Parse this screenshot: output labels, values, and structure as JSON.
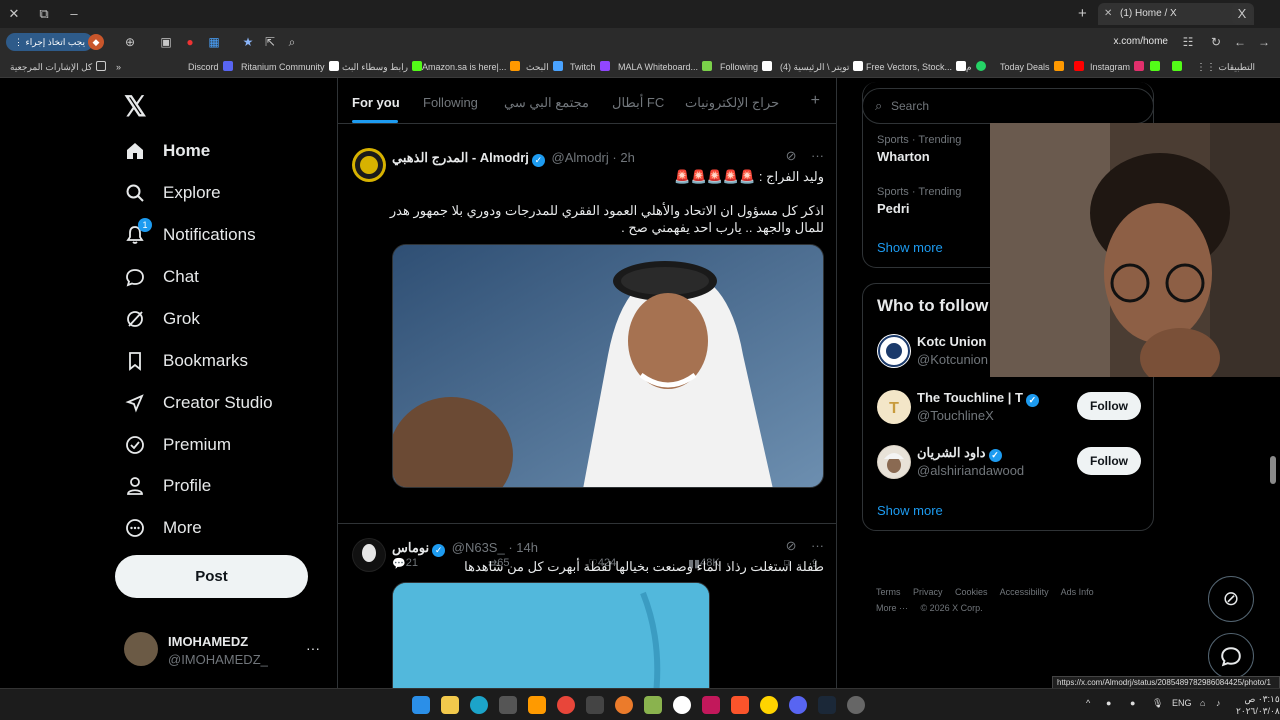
{
  "browser": {
    "tab_title": "(1) Home / X",
    "url": "x.com/home",
    "ext_button": "يجب اتخاذ إجراء",
    "bookmarks": [
      "كل الإشارات المرجعية",
      "Discord",
      "Ritanium Community",
      "رابط وسطاء البث",
      "Amazon.sa is here|...",
      "البحث",
      "Twitch",
      "MALA Whiteboard...",
      "Following",
      "تويتر \\ الرئيسية (4)",
      "Free Vectors, Stock...",
      "م",
      "Today Deals",
      "Instagram",
      "التطبيقات"
    ],
    "status_url": "https://x.com/Almodrj/status/2085489782986084425/photo/1"
  },
  "nav": {
    "items": [
      {
        "label": "Home",
        "icon": "home-icon"
      },
      {
        "label": "Explore",
        "icon": "search-icon"
      },
      {
        "label": "Notifications",
        "icon": "bell-icon",
        "badge": "1"
      },
      {
        "label": "Chat",
        "icon": "chat-icon"
      },
      {
        "label": "Grok",
        "icon": "grok-icon"
      },
      {
        "label": "Bookmarks",
        "icon": "bookmark-icon"
      },
      {
        "label": "Creator Studio",
        "icon": "rocket-icon"
      },
      {
        "label": "Premium",
        "icon": "verified-icon"
      },
      {
        "label": "Profile",
        "icon": "person-icon"
      },
      {
        "label": "More",
        "icon": "more-icon"
      }
    ],
    "post_label": "Post",
    "account": {
      "name": "IMOHAMEDZ",
      "handle": "@IMOHAMEDZ_"
    }
  },
  "timeline": {
    "tabs": [
      "For you",
      "Following",
      "مجتمع البي سي",
      "أبطال FC",
      "حراج الإلكترونيات"
    ],
    "tweets": [
      {
        "name": "المدرج الذهبي - Almodrj",
        "handle": "@Almodrj",
        "time": "2h",
        "text1": "وليد الفراج : 🚨🚨🚨🚨🚨",
        "text2": "اذكر كل مسؤول ان الاتحاد والأهلي العمود الفقري للمدرجات ودوري بلا جمهور هدر للمال والجهد .. يارب احد يفهمني صح .",
        "replies": "21",
        "reposts": "65",
        "likes": "424",
        "views": "48K"
      },
      {
        "name": "نوماس",
        "handle": "@N63S_",
        "time": "14h",
        "text1": "طفلة استغلت رذاذ الماء وصنعت بخيالها لقطة أبهرت كل من شاهدها"
      }
    ]
  },
  "sidebar": {
    "search_placeholder": "Search",
    "trends": [
      {
        "category": "Sports · Trending",
        "title": "Wharton"
      },
      {
        "category": "Sports · Trending",
        "title": "Pedri"
      }
    ],
    "show_more": "Show more",
    "who_to_follow": "Who to follow",
    "suggestions": [
      {
        "name": "Kotc Union",
        "handle": "@Kotcunion"
      },
      {
        "name": "The Touchline | T",
        "handle": "@TouchlineX",
        "button": "Follow"
      },
      {
        "name": "داود الشريان",
        "handle": "@alshiriandawood",
        "button": "Follow"
      }
    ],
    "footer": [
      "Terms",
      "Privacy",
      "Cookies",
      "Accessibility",
      "Ads Info",
      "More ···",
      "© 2026 X Corp."
    ]
  },
  "taskbar": {
    "lang": "ENG",
    "time": "٠٣:١٥ ص",
    "date": "٢٠٢٦/٠٣/٠٨"
  }
}
